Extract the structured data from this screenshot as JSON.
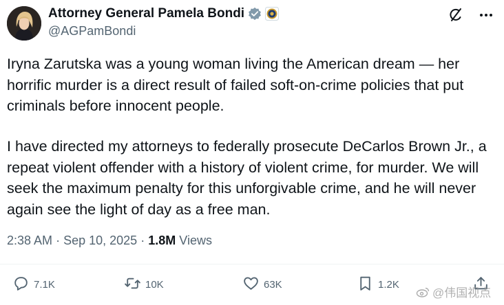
{
  "author": {
    "name": "Attorney General Pamela Bondi",
    "handle": "@AGPamBondi",
    "verified_icon": "verified-badge-icon",
    "affiliation_icon": "doj-seal-icon"
  },
  "top_actions": [
    "grok-icon",
    "more-icon"
  ],
  "post": {
    "paragraph_1": [
      "Iryna Zarutska was a young woman living the American dream — her",
      "horrific murder is a direct result of failed soft-on-crime policies that put",
      "criminals before innocent people."
    ],
    "paragraph_2": [
      "I have directed my attorneys to federally prosecute DeCarlos Brown Jr., a",
      "repeat violent offender with a history of violent crime, for murder. We will",
      "seek the maximum penalty for this unforgivable crime, and he will never",
      "again see the light of day as a free man."
    ]
  },
  "meta": {
    "time": "2:38 AM",
    "separator": "·",
    "date": "Sep 10, 2025",
    "views_count": "1.8M",
    "views_label": "Views"
  },
  "actions": {
    "replies": "7.1K",
    "reposts": "10K",
    "likes": "63K",
    "bookmarks": "1.2K"
  },
  "watermark": "@伟国视点",
  "colors": {
    "text": "#0f1419",
    "secondary": "#536471",
    "verified": "#829aab",
    "divider": "#eff3f4"
  }
}
